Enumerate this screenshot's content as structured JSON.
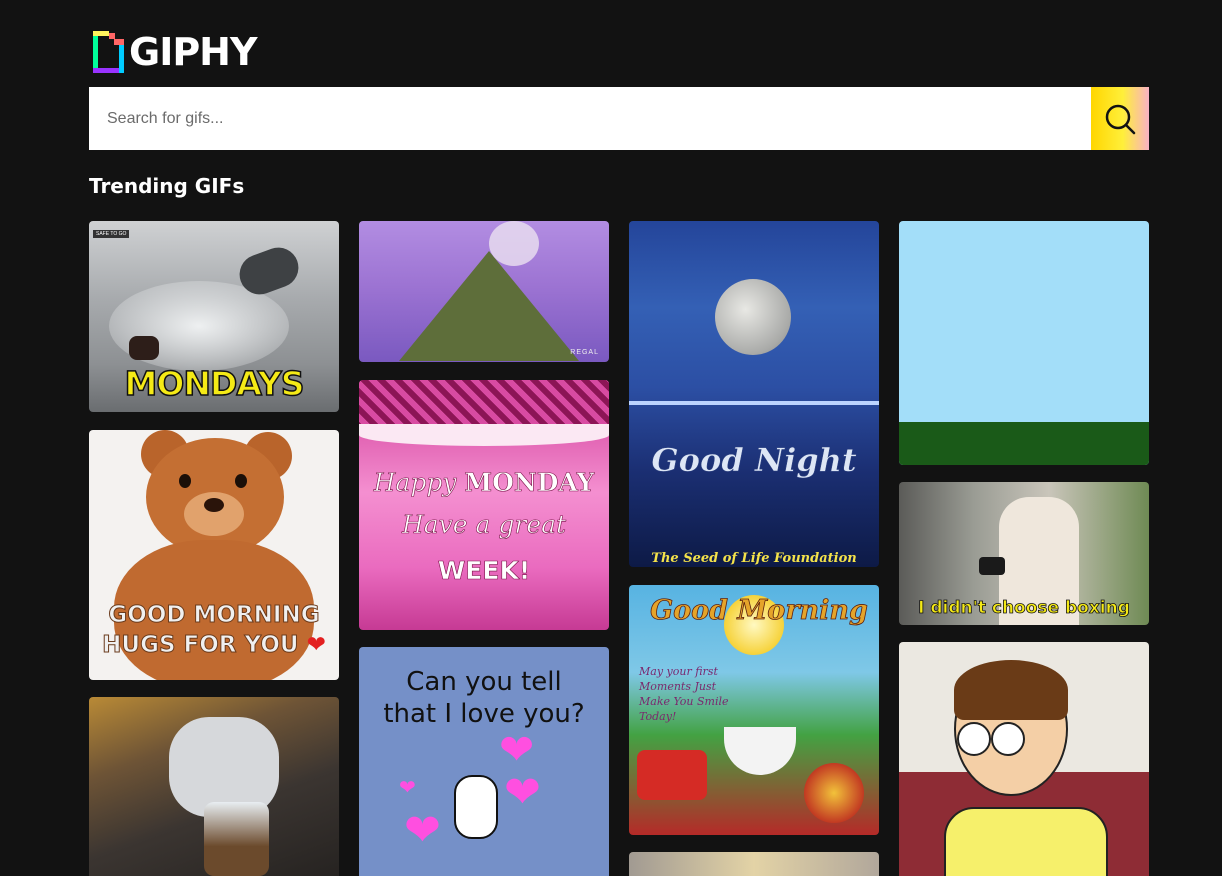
{
  "brand": {
    "name": "GIPHY"
  },
  "search": {
    "placeholder": "Search for gifs..."
  },
  "section": {
    "title": "Trending GIFs"
  },
  "gifs": {
    "mondays": {
      "caption": "MONDAYS",
      "badge": "SAFE TO GO"
    },
    "volcano": {
      "watermark": "REGAL"
    },
    "happy_monday": {
      "line1": "Happy",
      "line2": "MONDAY",
      "line3": "Have a great",
      "line4": "WEEK!"
    },
    "love": {
      "line1": "Can you tell",
      "line2": "that I love you?"
    },
    "bear": {
      "line1": "GOOD MORNING",
      "line2": "HUGS FOR YOU"
    },
    "good_night": {
      "title": "Good Night",
      "credit": "The Seed of Life Foundation"
    },
    "good_morning": {
      "title": "Good Morning",
      "line1": "May your first",
      "line2": "Moments Just",
      "line3": "Make You Smile",
      "line4": "Today!"
    },
    "boxing": {
      "caption": "I didn't choose boxing"
    }
  },
  "colors": {
    "background": "#121212",
    "caption_yellow": "#f5ea16",
    "sky": "#a3def9",
    "grass": "#1a5a18"
  }
}
